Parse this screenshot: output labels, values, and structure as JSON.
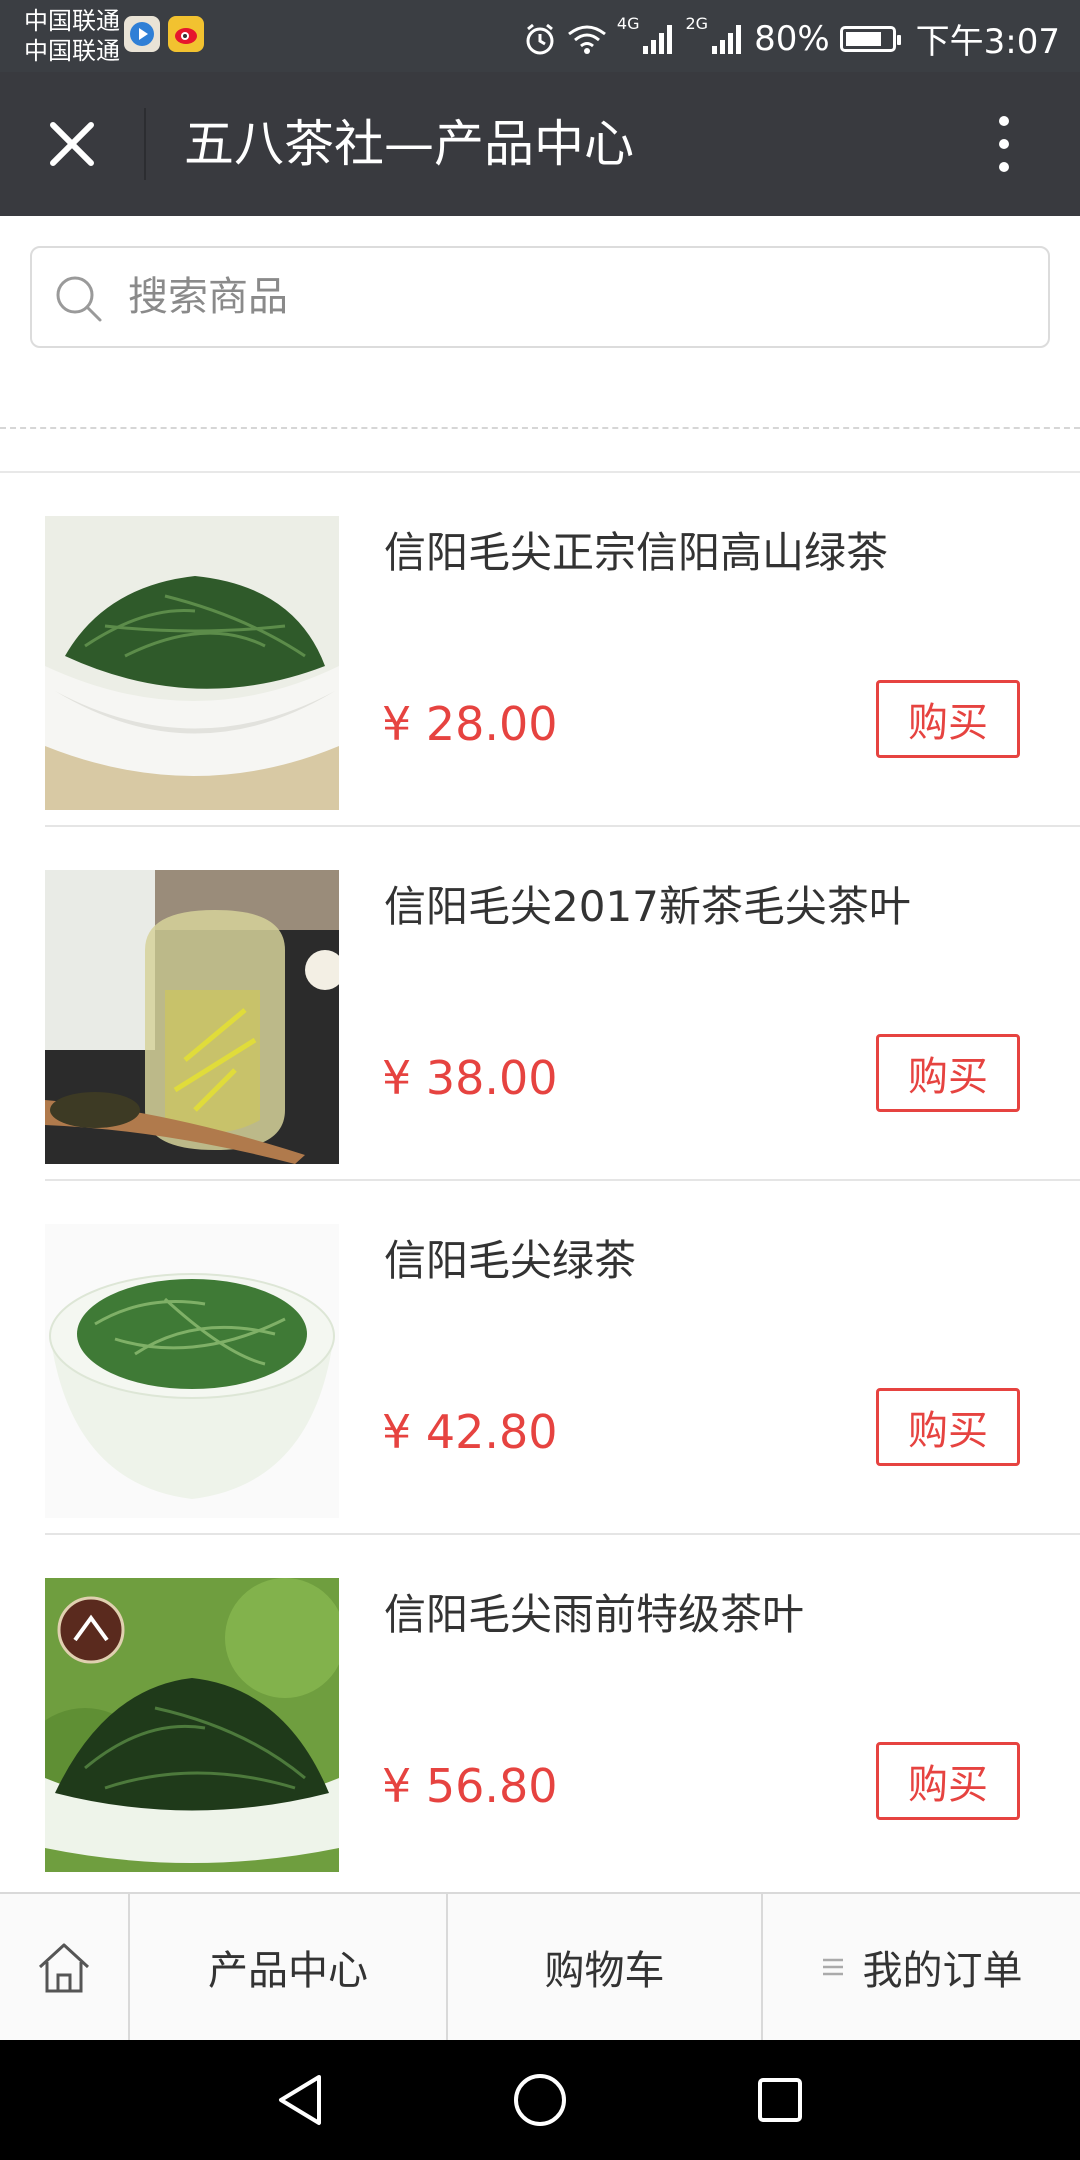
{
  "status_bar": {
    "carrier1": "中国联通",
    "carrier2": "中国联通",
    "network1": "4G",
    "network2": "2G",
    "battery": "80%",
    "battery_level": 0.8,
    "time": "下午3:07"
  },
  "titlebar": {
    "title": "五八茶社—产品中心"
  },
  "search": {
    "placeholder": "搜索商品",
    "value": ""
  },
  "products": [
    {
      "name": "信阳毛尖正宗信阳高山绿茶",
      "price": "¥ 28.00",
      "buy_label": "购买"
    },
    {
      "name": "信阳毛尖2017新茶毛尖茶叶",
      "price": "¥ 38.00",
      "buy_label": "购买"
    },
    {
      "name": "信阳毛尖绿茶",
      "price": "¥ 42.80",
      "buy_label": "购买"
    },
    {
      "name": "信阳毛尖雨前特级茶叶",
      "price": "¥ 56.80",
      "buy_label": "购买"
    }
  ],
  "bottom_nav": {
    "products": "产品中心",
    "cart": "购物车",
    "orders": "我的订单"
  },
  "colors": {
    "titlebar_bg": "#393a3f",
    "price": "#e64340",
    "buy_border": "#e64340"
  }
}
